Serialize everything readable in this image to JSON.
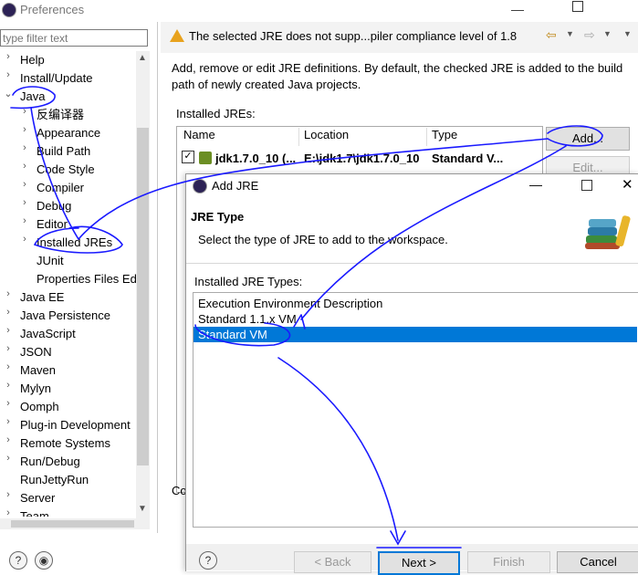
{
  "window": {
    "title": "Preferences"
  },
  "filter": {
    "placeholder": "type filter text"
  },
  "tree": {
    "items": [
      {
        "label": "Help",
        "chevron": "›"
      },
      {
        "label": "Install/Update",
        "chevron": "›"
      },
      {
        "label": "Java",
        "chevron": "⌄"
      },
      {
        "label": "反编译器",
        "chevron": "›"
      },
      {
        "label": "Appearance",
        "chevron": "›"
      },
      {
        "label": "Build Path",
        "chevron": "›"
      },
      {
        "label": "Code Style",
        "chevron": "›"
      },
      {
        "label": "Compiler",
        "chevron": "›"
      },
      {
        "label": "Debug",
        "chevron": "›"
      },
      {
        "label": "Editor",
        "chevron": "›"
      },
      {
        "label": "Installed JREs",
        "chevron": "›"
      },
      {
        "label": "JUnit",
        "chevron": ""
      },
      {
        "label": "Properties Files Ed",
        "chevron": ""
      },
      {
        "label": "Java EE",
        "chevron": "›"
      },
      {
        "label": "Java Persistence",
        "chevron": "›"
      },
      {
        "label": "JavaScript",
        "chevron": "›"
      },
      {
        "label": "JSON",
        "chevron": "›"
      },
      {
        "label": "Maven",
        "chevron": "›"
      },
      {
        "label": "Mylyn",
        "chevron": "›"
      },
      {
        "label": "Oomph",
        "chevron": "›"
      },
      {
        "label": "Plug-in Development",
        "chevron": "›"
      },
      {
        "label": "Remote Systems",
        "chevron": "›"
      },
      {
        "label": "Run/Debug",
        "chevron": "›"
      },
      {
        "label": "RunJettyRun",
        "chevron": ""
      },
      {
        "label": "Server",
        "chevron": "›"
      },
      {
        "label": "Team",
        "chevron": "›"
      }
    ]
  },
  "page": {
    "warning": "The selected JRE does not supp...piler compliance level of 1.8",
    "description": "Add, remove or edit JRE definitions. By default, the checked JRE is added to the build path of newly created Java projects.",
    "installed_label": "Installed JREs:",
    "columns": [
      "Name",
      "Location",
      "Type"
    ],
    "row": {
      "name": "jdk1.7.0_10 (...",
      "location": "E:\\jdk1.7\\jdk1.7.0_10",
      "type": "Standard V...",
      "checked": "✓"
    },
    "add_label": "Add...",
    "edit_label": "Edit...",
    "co_text": "Co"
  },
  "dialog": {
    "title": "Add JRE",
    "heading": "JRE Type",
    "subtitle": "Select the type of JRE to add to the workspace.",
    "types_label": "Installed JRE Types:",
    "types": [
      "Execution Environment Description",
      "Standard 1.1.x VM",
      "Standard VM"
    ],
    "selected_index": 2,
    "back_label": "< Back",
    "next_label": "Next >",
    "finish_label": "Finish",
    "cancel_label": "Cancel"
  },
  "colors": {
    "selection": "#0078d7",
    "ink": "#1a1aff",
    "warning": "#e8a21d"
  }
}
